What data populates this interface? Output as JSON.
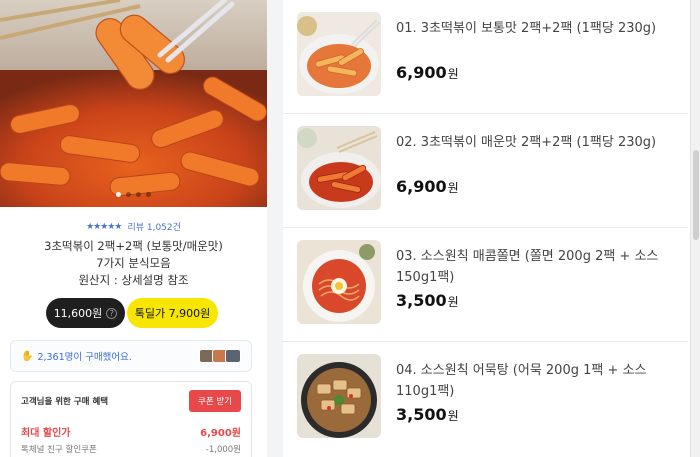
{
  "product": {
    "review_link": "리뷰 1,052건",
    "title_lines": [
      "3초떡볶이 2팩+2팩 (보통맛/매운맛)",
      "7가지 분식모음",
      "원산지 : 상세설명 참조"
    ],
    "price_button": "11,600원",
    "deal_button": "톡딜가 7,900원",
    "buyers_text": "2,361명이 구매했어요.",
    "benefit": {
      "heading": "고객님을 위한 구매 혜택",
      "coupon_button": "쿠폰 받기",
      "max_discount_label": "최대 할인가",
      "max_discount_price": "6,900원",
      "coupon_name": "톡체널 친구 할인쿠폰",
      "coupon_amount": "-1,000원"
    },
    "rating_stars": 4.5
  },
  "options": [
    {
      "name": "01. 3초떡볶이 보통맛 2팩+2팩 (1팩당 230g)",
      "price": "6,900",
      "unit": "원",
      "image": "mild-tteokbokki-photo"
    },
    {
      "name": "02. 3초떡볶이 매운맛 2팩+2팩 (1팩당 230g)",
      "price": "6,900",
      "unit": "원",
      "image": "spicy-tteokbokki-photo"
    },
    {
      "name": "03. 소스원칙 매콤쫄면 (쫄면 200g 2팩 + 소스 150g1팩)",
      "price": "3,500",
      "unit": "원",
      "image": "jjolmyeon-photo"
    },
    {
      "name": "04. 소스원칙 어묵탕 (어묵 200g 1팩 + 소스 110g1팩)",
      "price": "3,500",
      "unit": "원",
      "image": "fishcake-soup-photo"
    }
  ],
  "colors": {
    "deal_yellow": "#f7e600",
    "coupon_red": "#e8484a",
    "link_blue": "#4a74c9"
  }
}
